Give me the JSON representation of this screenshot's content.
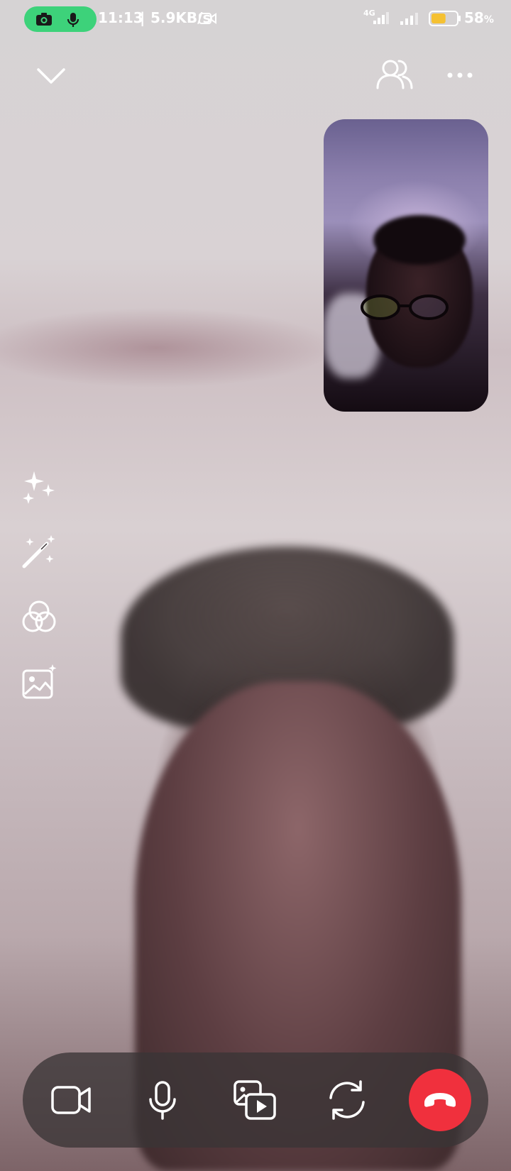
{
  "status_bar": {
    "time": "11:13",
    "separator": "|",
    "net_speed": "5.9KB/s",
    "network_type": "4G",
    "battery_percent": "58",
    "battery_suffix": "%",
    "battery_level": 0.58,
    "recording_indicator_color": "#3dd27a",
    "icons": [
      "camera-icon",
      "microphone-icon",
      "video-status-icon",
      "signal-4g-icon",
      "signal-icon",
      "battery-icon"
    ]
  },
  "top_bar": {
    "icons": [
      "chevron-down-icon",
      "participants-icon",
      "more-icon"
    ]
  },
  "side_tools": {
    "icons": [
      "sparkles-icon",
      "magic-wand-icon",
      "color-filter-icon",
      "background-image-icon"
    ]
  },
  "controls": {
    "icons": [
      "video-camera-icon",
      "microphone-icon",
      "share-media-icon",
      "switch-camera-icon",
      "end-call-icon"
    ],
    "end_call_color": "#f0303d"
  }
}
